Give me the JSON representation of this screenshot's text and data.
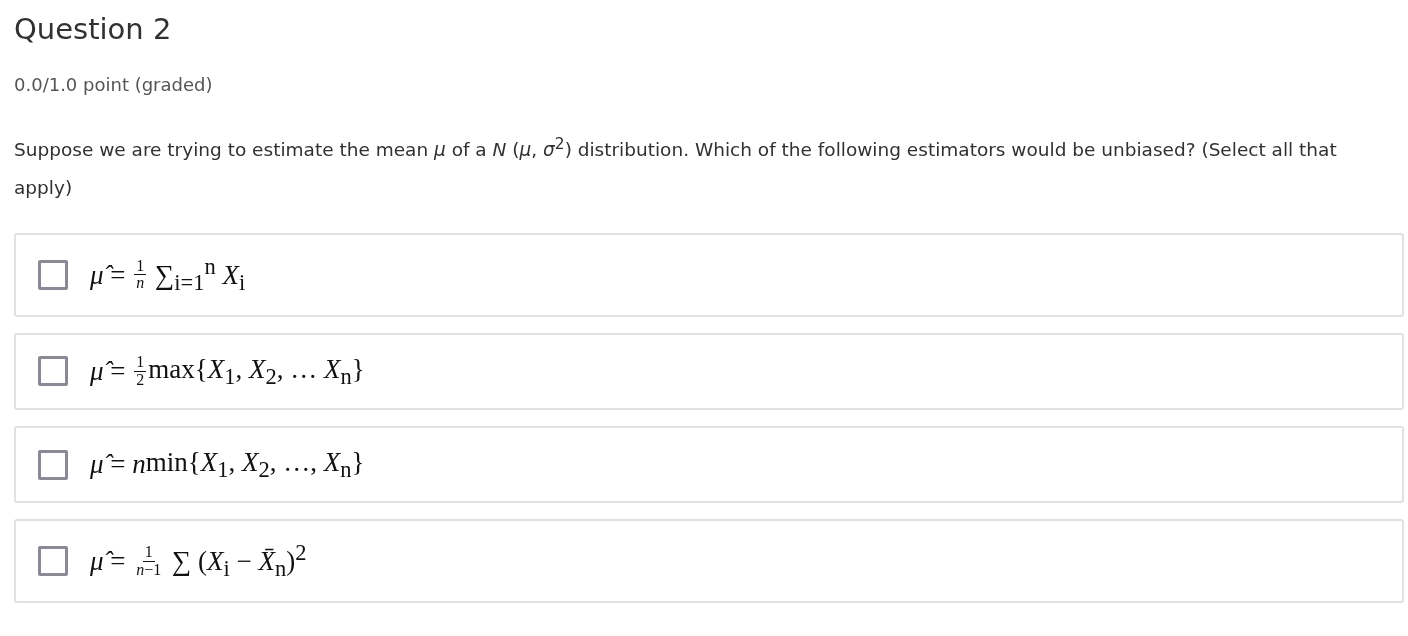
{
  "title": "Question 2",
  "points": "0.0/1.0 point (graded)",
  "prompt": "Suppose we are trying to estimate the mean *μ* of a *N* (*μ*, *σ*$^{2}$) distribution. Which of the following estimators would be unbiased? (Select all that apply)",
  "options": [
    {
      "checked": false,
      "parts": [
        {
          "kind": "text",
          "text": "*μ̂* = "
        },
        {
          "kind": "frac",
          "num": "1",
          "den": "*n*"
        },
        {
          "kind": "text",
          "text": " ∑$_{i=1}$$^{n}$ *X*$_{i}$"
        }
      ]
    },
    {
      "checked": false,
      "parts": [
        {
          "kind": "text",
          "text": "*μ̂* = "
        },
        {
          "kind": "frac",
          "num": "1",
          "den": "2"
        },
        {
          "kind": "text",
          "text": "max{*X*$_{1}$, *X*$_{2}$, … *X*$_{n}$}"
        }
      ]
    },
    {
      "checked": false,
      "parts": [
        {
          "kind": "text",
          "text": "*μ̂* = "
        },
        {
          "kind": "text",
          "text": "*n*"
        },
        {
          "kind": "text",
          "text": "min{*X*$_{1}$, *X*$_{2}$, …, *X*$_{n}$}"
        }
      ]
    },
    {
      "checked": false,
      "parts": [
        {
          "kind": "text",
          "text": "*μ̂* = "
        },
        {
          "kind": "frac",
          "num": "1",
          "den": "*n*−1"
        },
        {
          "kind": "text",
          "text": " ∑ (*X*$_{i}$ − *X̄*$_{n}$)$^{2}$"
        }
      ]
    }
  ]
}
